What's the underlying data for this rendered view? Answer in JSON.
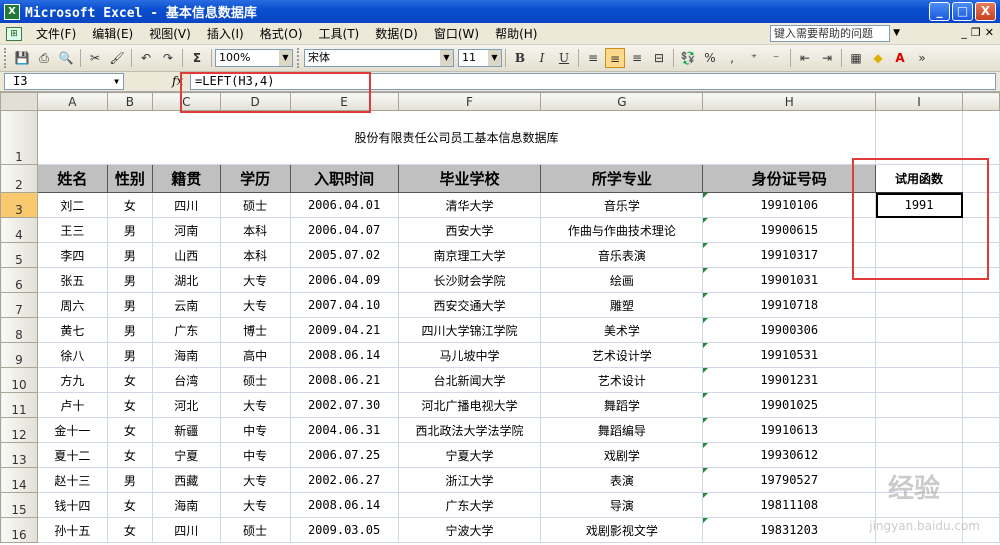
{
  "window": {
    "title": "Microsoft Excel - 基本信息数据库",
    "min": "_",
    "max": "□",
    "close": "X"
  },
  "menu": {
    "items": [
      "文件(F)",
      "编辑(E)",
      "视图(V)",
      "插入(I)",
      "格式(O)",
      "工具(T)",
      "数据(D)",
      "窗口(W)",
      "帮助(H)"
    ],
    "help_placeholder": "键入需要帮助的问题"
  },
  "toolbar": {
    "zoom": "100%",
    "font_name": "宋体",
    "font_size": "11",
    "bold": "B",
    "italic": "I",
    "underline": "U"
  },
  "formula_bar": {
    "name_box": "I3",
    "fx": "fx",
    "formula": "=LEFT(H3,4)"
  },
  "columns": [
    "A",
    "B",
    "C",
    "D",
    "E",
    "F",
    "G",
    "H",
    "I"
  ],
  "sheet_title": "股份有限责任公司员工基本信息数据库",
  "headers": [
    "姓名",
    "性别",
    "籍贯",
    "学历",
    "入职时间",
    "毕业学校",
    "所学专业",
    "身份证号码"
  ],
  "test_header": "试用函数",
  "test_value": "1991",
  "rows": [
    {
      "n": "3",
      "c": [
        "刘二",
        "女",
        "四川",
        "硕士",
        "2006.04.01",
        "清华大学",
        "音乐学",
        "19910106"
      ]
    },
    {
      "n": "4",
      "c": [
        "王三",
        "男",
        "河南",
        "本科",
        "2006.04.07",
        "西安大学",
        "作曲与作曲技术理论",
        "19900615"
      ]
    },
    {
      "n": "5",
      "c": [
        "李四",
        "男",
        "山西",
        "本科",
        "2005.07.02",
        "南京理工大学",
        "音乐表演",
        "19910317"
      ]
    },
    {
      "n": "6",
      "c": [
        "张五",
        "男",
        "湖北",
        "大专",
        "2006.04.09",
        "长沙财会学院",
        "绘画",
        "19901031"
      ]
    },
    {
      "n": "7",
      "c": [
        "周六",
        "男",
        "云南",
        "大专",
        "2007.04.10",
        "西安交通大学",
        "雕塑",
        "19910718"
      ]
    },
    {
      "n": "8",
      "c": [
        "黄七",
        "男",
        "广东",
        "博士",
        "2009.04.21",
        "四川大学锦江学院",
        "美术学",
        "19900306"
      ]
    },
    {
      "n": "9",
      "c": [
        "徐八",
        "男",
        "海南",
        "高中",
        "2008.06.14",
        "马儿坡中学",
        "艺术设计学",
        "19910531"
      ]
    },
    {
      "n": "10",
      "c": [
        "方九",
        "女",
        "台湾",
        "硕士",
        "2008.06.21",
        "台北新闻大学",
        "艺术设计",
        "19901231"
      ]
    },
    {
      "n": "11",
      "c": [
        "卢十",
        "女",
        "河北",
        "大专",
        "2002.07.30",
        "河北广播电视大学",
        "舞蹈学",
        "19901025"
      ]
    },
    {
      "n": "12",
      "c": [
        "金十一",
        "女",
        "新疆",
        "中专",
        "2004.06.31",
        "西北政法大学法学院",
        "舞蹈编导",
        "19910613"
      ]
    },
    {
      "n": "13",
      "c": [
        "夏十二",
        "女",
        "宁夏",
        "中专",
        "2006.07.25",
        "宁夏大学",
        "戏剧学",
        "19930612"
      ]
    },
    {
      "n": "14",
      "c": [
        "赵十三",
        "男",
        "西藏",
        "大专",
        "2002.06.27",
        "浙江大学",
        "表演",
        "19790527"
      ]
    },
    {
      "n": "15",
      "c": [
        "钱十四",
        "女",
        "海南",
        "大专",
        "2008.06.14",
        "广东大学",
        "导演",
        "19811108"
      ]
    },
    {
      "n": "16",
      "c": [
        "孙十五",
        "女",
        "四川",
        "硕士",
        "2009.03.05",
        "宁波大学",
        "戏剧影视文学",
        "19831203"
      ]
    }
  ],
  "watermark": "经验",
  "watermark_sub": "jingyan.baidu.com",
  "colors": {
    "title_bar": "#0a4fd0",
    "highlight_box": "#e03a3a",
    "header_fill": "#c0c0c0",
    "selected_header": "#f9c96e"
  }
}
